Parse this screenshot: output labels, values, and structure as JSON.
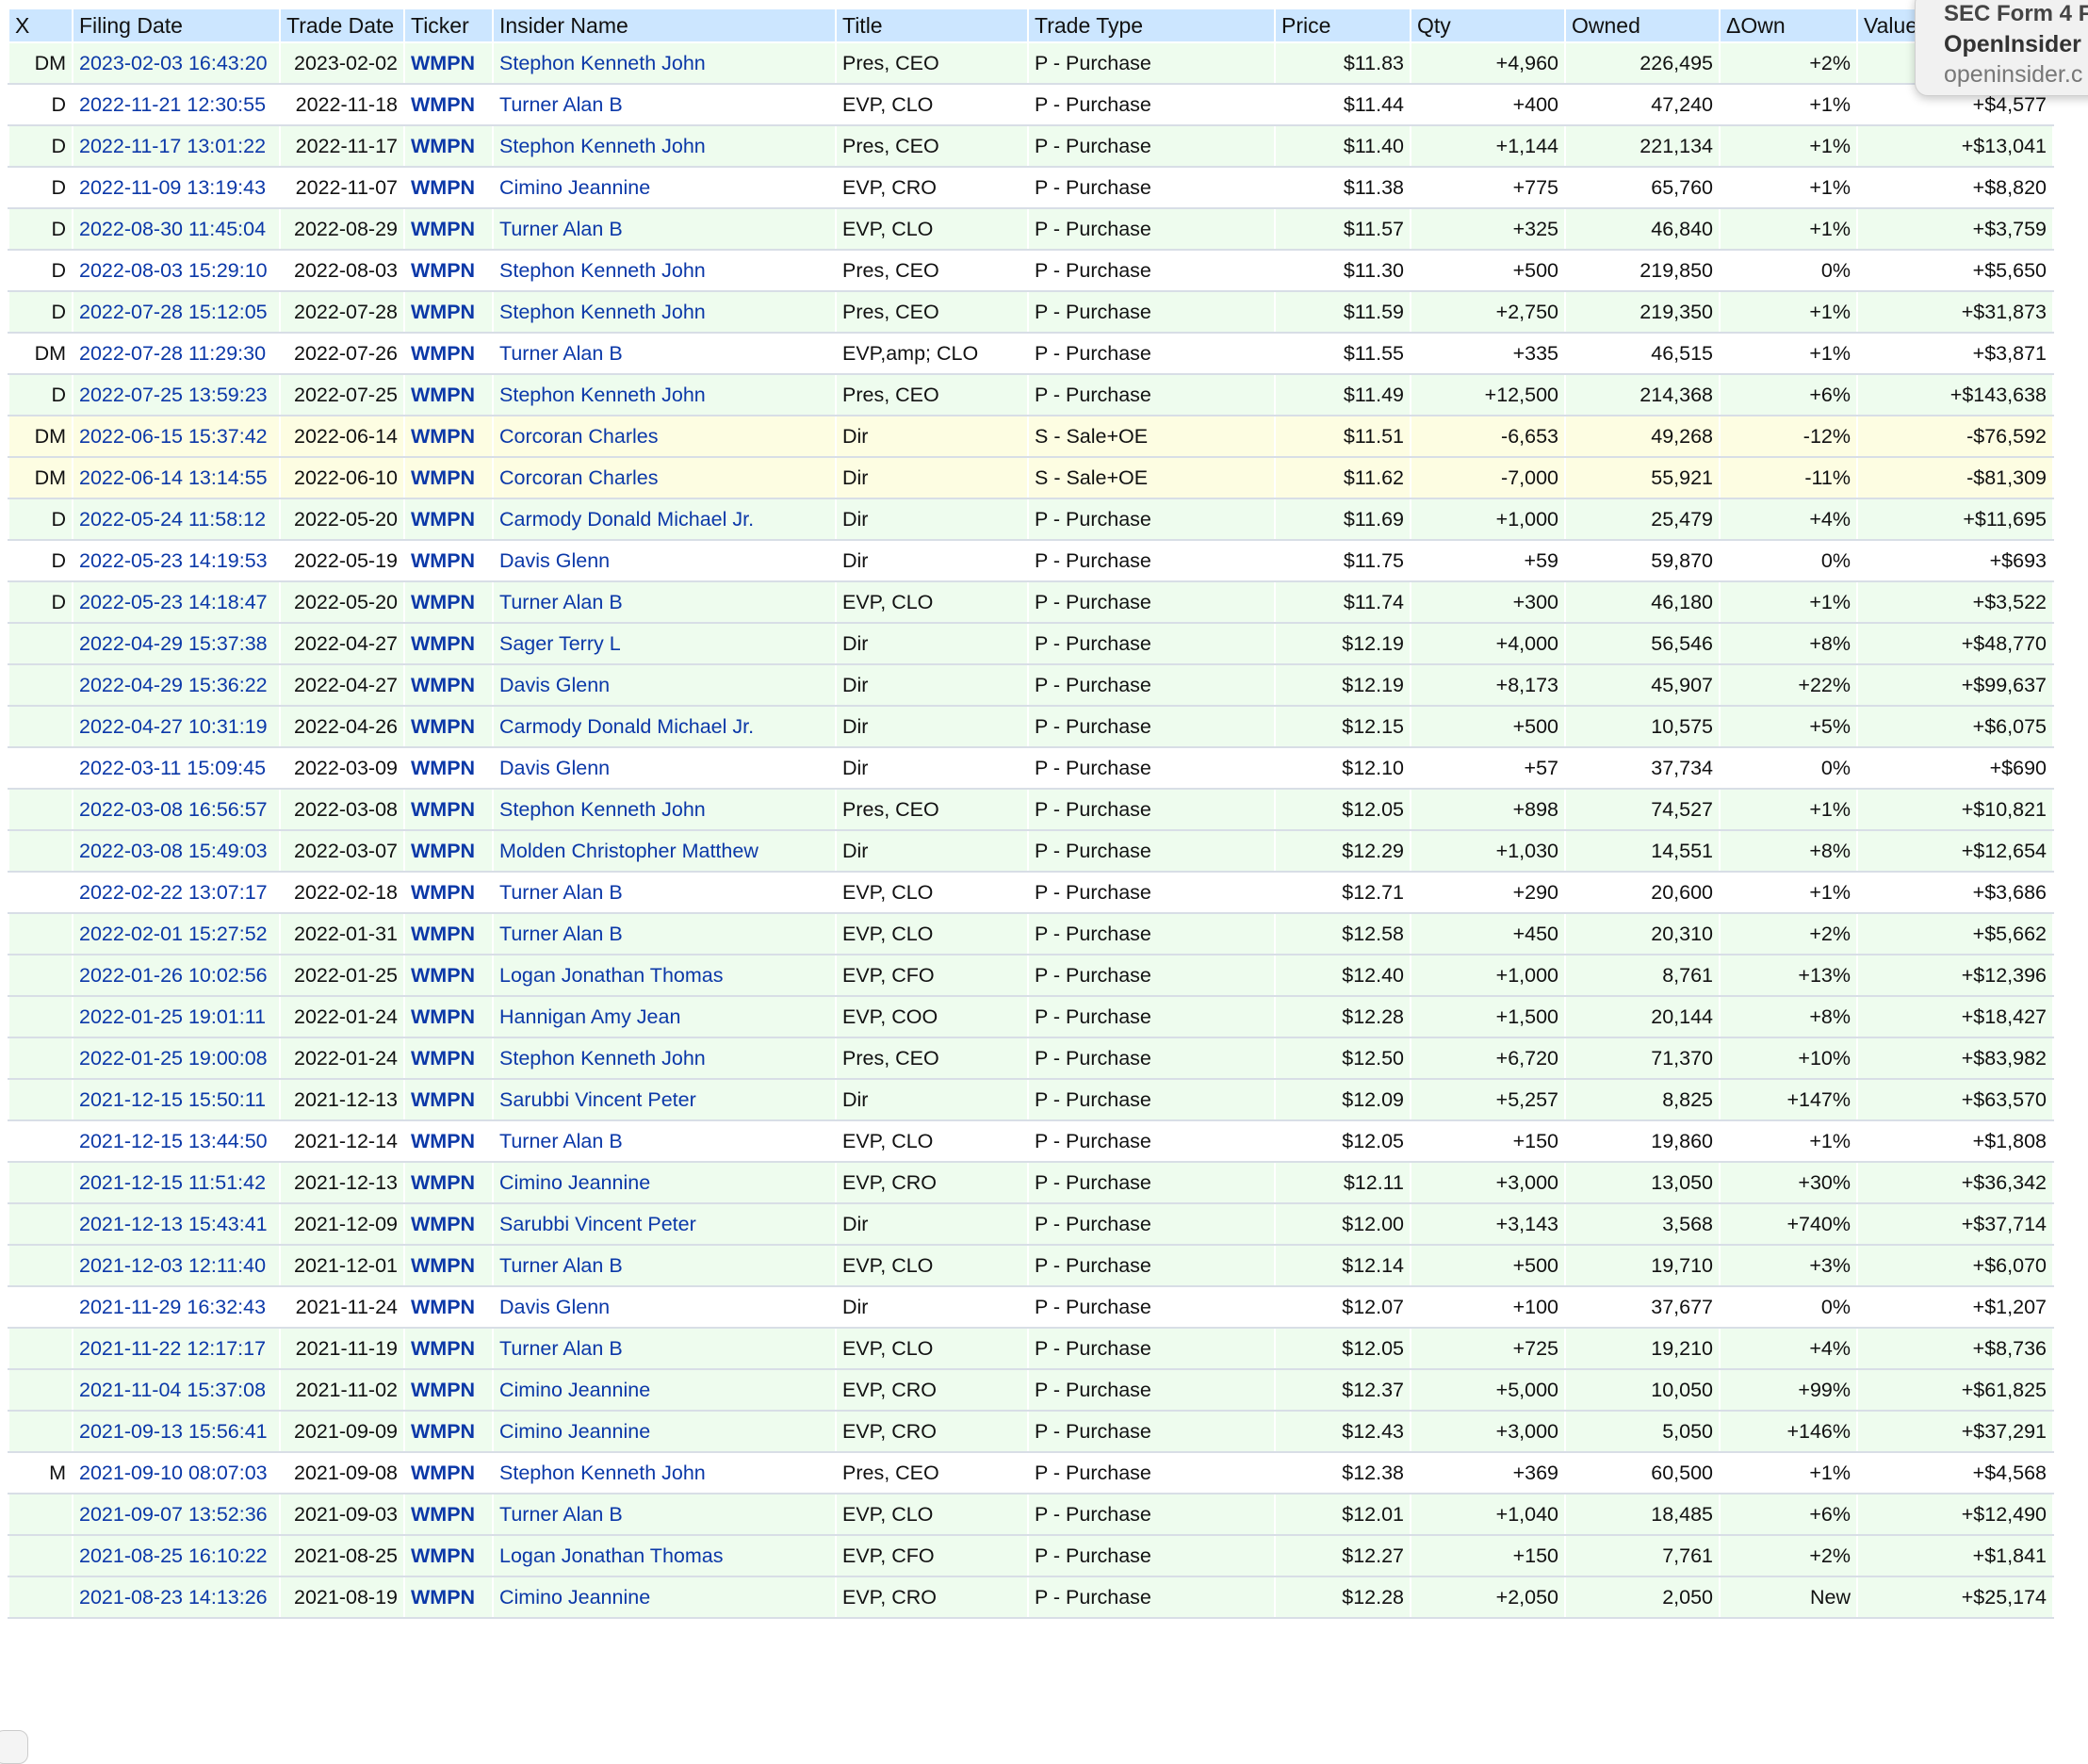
{
  "columns": [
    "X",
    "Filing Date",
    "Trade Date",
    "Ticker",
    "Insider Name",
    "Title",
    "Trade Type",
    "Price",
    "Qty",
    "Owned",
    "ΔOwn",
    "Value"
  ],
  "tooltip": {
    "line1": "SEC Form 4 F",
    "line2": "OpenInsider",
    "line3": "openinsider.c"
  },
  "rows": [
    {
      "x": "DM",
      "filing": "2023-02-03 16:43:20",
      "trade": "2023-02-02",
      "ticker": "WMPN",
      "name": "Stephon Kenneth John",
      "title": "Pres, CEO",
      "type": "P - Purchase",
      "price": "$11.83",
      "qty": "+4,960",
      "owned": "226,495",
      "down": "+2%",
      "value": "",
      "kind": "buy"
    },
    {
      "x": "D",
      "filing": "2022-11-21 12:30:55",
      "trade": "2022-11-18",
      "ticker": "WMPN",
      "name": "Turner Alan B",
      "title": "EVP, CLO",
      "type": "P - Purchase",
      "price": "$11.44",
      "qty": "+400",
      "owned": "47,240",
      "down": "+1%",
      "value": "+$4,577",
      "kind": "plain"
    },
    {
      "x": "D",
      "filing": "2022-11-17 13:01:22",
      "trade": "2022-11-17",
      "ticker": "WMPN",
      "name": "Stephon Kenneth John",
      "title": "Pres, CEO",
      "type": "P - Purchase",
      "price": "$11.40",
      "qty": "+1,144",
      "owned": "221,134",
      "down": "+1%",
      "value": "+$13,041",
      "kind": "buy"
    },
    {
      "x": "D",
      "filing": "2022-11-09 13:19:43",
      "trade": "2022-11-07",
      "ticker": "WMPN",
      "name": "Cimino Jeannine",
      "title": "EVP, CRO",
      "type": "P - Purchase",
      "price": "$11.38",
      "qty": "+775",
      "owned": "65,760",
      "down": "+1%",
      "value": "+$8,820",
      "kind": "plain"
    },
    {
      "x": "D",
      "filing": "2022-08-30 11:45:04",
      "trade": "2022-08-29",
      "ticker": "WMPN",
      "name": "Turner Alan B",
      "title": "EVP, CLO",
      "type": "P - Purchase",
      "price": "$11.57",
      "qty": "+325",
      "owned": "46,840",
      "down": "+1%",
      "value": "+$3,759",
      "kind": "buy"
    },
    {
      "x": "D",
      "filing": "2022-08-03 15:29:10",
      "trade": "2022-08-03",
      "ticker": "WMPN",
      "name": "Stephon Kenneth John",
      "title": "Pres, CEO",
      "type": "P - Purchase",
      "price": "$11.30",
      "qty": "+500",
      "owned": "219,850",
      "down": "0%",
      "value": "+$5,650",
      "kind": "plain"
    },
    {
      "x": "D",
      "filing": "2022-07-28 15:12:05",
      "trade": "2022-07-28",
      "ticker": "WMPN",
      "name": "Stephon Kenneth John",
      "title": "Pres, CEO",
      "type": "P - Purchase",
      "price": "$11.59",
      "qty": "+2,750",
      "owned": "219,350",
      "down": "+1%",
      "value": "+$31,873",
      "kind": "buy"
    },
    {
      "x": "DM",
      "filing": "2022-07-28 11:29:30",
      "trade": "2022-07-26",
      "ticker": "WMPN",
      "name": "Turner Alan B",
      "title": "EVP,amp; CLO",
      "type": "P - Purchase",
      "price": "$11.55",
      "qty": "+335",
      "owned": "46,515",
      "down": "+1%",
      "value": "+$3,871",
      "kind": "plain"
    },
    {
      "x": "D",
      "filing": "2022-07-25 13:59:23",
      "trade": "2022-07-25",
      "ticker": "WMPN",
      "name": "Stephon Kenneth John",
      "title": "Pres, CEO",
      "type": "P - Purchase",
      "price": "$11.49",
      "qty": "+12,500",
      "owned": "214,368",
      "down": "+6%",
      "value": "+$143,638",
      "kind": "buy"
    },
    {
      "x": "DM",
      "filing": "2022-06-15 15:37:42",
      "trade": "2022-06-14",
      "ticker": "WMPN",
      "name": "Corcoran Charles",
      "title": "Dir",
      "type": "S - Sale+OE",
      "price": "$11.51",
      "qty": "-6,653",
      "owned": "49,268",
      "down": "-12%",
      "value": "-$76,592",
      "kind": "sell"
    },
    {
      "x": "DM",
      "filing": "2022-06-14 13:14:55",
      "trade": "2022-06-10",
      "ticker": "WMPN",
      "name": "Corcoran Charles",
      "title": "Dir",
      "type": "S - Sale+OE",
      "price": "$11.62",
      "qty": "-7,000",
      "owned": "55,921",
      "down": "-11%",
      "value": "-$81,309",
      "kind": "sell"
    },
    {
      "x": "D",
      "filing": "2022-05-24 11:58:12",
      "trade": "2022-05-20",
      "ticker": "WMPN",
      "name": "Carmody Donald Michael Jr.",
      "title": "Dir",
      "type": "P - Purchase",
      "price": "$11.69",
      "qty": "+1,000",
      "owned": "25,479",
      "down": "+4%",
      "value": "+$11,695",
      "kind": "buy"
    },
    {
      "x": "D",
      "filing": "2022-05-23 14:19:53",
      "trade": "2022-05-19",
      "ticker": "WMPN",
      "name": "Davis Glenn",
      "title": "Dir",
      "type": "P - Purchase",
      "price": "$11.75",
      "qty": "+59",
      "owned": "59,870",
      "down": "0%",
      "value": "+$693",
      "kind": "plain"
    },
    {
      "x": "D",
      "filing": "2022-05-23 14:18:47",
      "trade": "2022-05-20",
      "ticker": "WMPN",
      "name": "Turner Alan B",
      "title": "EVP, CLO",
      "type": "P - Purchase",
      "price": "$11.74",
      "qty": "+300",
      "owned": "46,180",
      "down": "+1%",
      "value": "+$3,522",
      "kind": "buy"
    },
    {
      "x": "",
      "filing": "2022-04-29 15:37:38",
      "trade": "2022-04-27",
      "ticker": "WMPN",
      "name": "Sager Terry L",
      "title": "Dir",
      "type": "P - Purchase",
      "price": "$12.19",
      "qty": "+4,000",
      "owned": "56,546",
      "down": "+8%",
      "value": "+$48,770",
      "kind": "buy"
    },
    {
      "x": "",
      "filing": "2022-04-29 15:36:22",
      "trade": "2022-04-27",
      "ticker": "WMPN",
      "name": "Davis Glenn",
      "title": "Dir",
      "type": "P - Purchase",
      "price": "$12.19",
      "qty": "+8,173",
      "owned": "45,907",
      "down": "+22%",
      "value": "+$99,637",
      "kind": "buy"
    },
    {
      "x": "",
      "filing": "2022-04-27 10:31:19",
      "trade": "2022-04-26",
      "ticker": "WMPN",
      "name": "Carmody Donald Michael Jr.",
      "title": "Dir",
      "type": "P - Purchase",
      "price": "$12.15",
      "qty": "+500",
      "owned": "10,575",
      "down": "+5%",
      "value": "+$6,075",
      "kind": "buy"
    },
    {
      "x": "",
      "filing": "2022-03-11 15:09:45",
      "trade": "2022-03-09",
      "ticker": "WMPN",
      "name": "Davis Glenn",
      "title": "Dir",
      "type": "P - Purchase",
      "price": "$12.10",
      "qty": "+57",
      "owned": "37,734",
      "down": "0%",
      "value": "+$690",
      "kind": "plain"
    },
    {
      "x": "",
      "filing": "2022-03-08 16:56:57",
      "trade": "2022-03-08",
      "ticker": "WMPN",
      "name": "Stephon Kenneth John",
      "title": "Pres, CEO",
      "type": "P - Purchase",
      "price": "$12.05",
      "qty": "+898",
      "owned": "74,527",
      "down": "+1%",
      "value": "+$10,821",
      "kind": "buy"
    },
    {
      "x": "",
      "filing": "2022-03-08 15:49:03",
      "trade": "2022-03-07",
      "ticker": "WMPN",
      "name": "Molden Christopher Matthew",
      "title": "Dir",
      "type": "P - Purchase",
      "price": "$12.29",
      "qty": "+1,030",
      "owned": "14,551",
      "down": "+8%",
      "value": "+$12,654",
      "kind": "buy"
    },
    {
      "x": "",
      "filing": "2022-02-22 13:07:17",
      "trade": "2022-02-18",
      "ticker": "WMPN",
      "name": "Turner Alan B",
      "title": "EVP, CLO",
      "type": "P - Purchase",
      "price": "$12.71",
      "qty": "+290",
      "owned": "20,600",
      "down": "+1%",
      "value": "+$3,686",
      "kind": "plain"
    },
    {
      "x": "",
      "filing": "2022-02-01 15:27:52",
      "trade": "2022-01-31",
      "ticker": "WMPN",
      "name": "Turner Alan B",
      "title": "EVP, CLO",
      "type": "P - Purchase",
      "price": "$12.58",
      "qty": "+450",
      "owned": "20,310",
      "down": "+2%",
      "value": "+$5,662",
      "kind": "buy"
    },
    {
      "x": "",
      "filing": "2022-01-26 10:02:56",
      "trade": "2022-01-25",
      "ticker": "WMPN",
      "name": "Logan Jonathan Thomas",
      "title": "EVP, CFO",
      "type": "P - Purchase",
      "price": "$12.40",
      "qty": "+1,000",
      "owned": "8,761",
      "down": "+13%",
      "value": "+$12,396",
      "kind": "buy"
    },
    {
      "x": "",
      "filing": "2022-01-25 19:01:11",
      "trade": "2022-01-24",
      "ticker": "WMPN",
      "name": "Hannigan Amy Jean",
      "title": "EVP, COO",
      "type": "P - Purchase",
      "price": "$12.28",
      "qty": "+1,500",
      "owned": "20,144",
      "down": "+8%",
      "value": "+$18,427",
      "kind": "buy"
    },
    {
      "x": "",
      "filing": "2022-01-25 19:00:08",
      "trade": "2022-01-24",
      "ticker": "WMPN",
      "name": "Stephon Kenneth John",
      "title": "Pres, CEO",
      "type": "P - Purchase",
      "price": "$12.50",
      "qty": "+6,720",
      "owned": "71,370",
      "down": "+10%",
      "value": "+$83,982",
      "kind": "buy"
    },
    {
      "x": "",
      "filing": "2021-12-15 15:50:11",
      "trade": "2021-12-13",
      "ticker": "WMPN",
      "name": "Sarubbi Vincent Peter",
      "title": "Dir",
      "type": "P - Purchase",
      "price": "$12.09",
      "qty": "+5,257",
      "owned": "8,825",
      "down": "+147%",
      "value": "+$63,570",
      "kind": "buy"
    },
    {
      "x": "",
      "filing": "2021-12-15 13:44:50",
      "trade": "2021-12-14",
      "ticker": "WMPN",
      "name": "Turner Alan B",
      "title": "EVP, CLO",
      "type": "P - Purchase",
      "price": "$12.05",
      "qty": "+150",
      "owned": "19,860",
      "down": "+1%",
      "value": "+$1,808",
      "kind": "plain"
    },
    {
      "x": "",
      "filing": "2021-12-15 11:51:42",
      "trade": "2021-12-13",
      "ticker": "WMPN",
      "name": "Cimino Jeannine",
      "title": "EVP, CRO",
      "type": "P - Purchase",
      "price": "$12.11",
      "qty": "+3,000",
      "owned": "13,050",
      "down": "+30%",
      "value": "+$36,342",
      "kind": "buy"
    },
    {
      "x": "",
      "filing": "2021-12-13 15:43:41",
      "trade": "2021-12-09",
      "ticker": "WMPN",
      "name": "Sarubbi Vincent Peter",
      "title": "Dir",
      "type": "P - Purchase",
      "price": "$12.00",
      "qty": "+3,143",
      "owned": "3,568",
      "down": "+740%",
      "value": "+$37,714",
      "kind": "buy"
    },
    {
      "x": "",
      "filing": "2021-12-03 12:11:40",
      "trade": "2021-12-01",
      "ticker": "WMPN",
      "name": "Turner Alan B",
      "title": "EVP, CLO",
      "type": "P - Purchase",
      "price": "$12.14",
      "qty": "+500",
      "owned": "19,710",
      "down": "+3%",
      "value": "+$6,070",
      "kind": "buy"
    },
    {
      "x": "",
      "filing": "2021-11-29 16:32:43",
      "trade": "2021-11-24",
      "ticker": "WMPN",
      "name": "Davis Glenn",
      "title": "Dir",
      "type": "P - Purchase",
      "price": "$12.07",
      "qty": "+100",
      "owned": "37,677",
      "down": "0%",
      "value": "+$1,207",
      "kind": "plain"
    },
    {
      "x": "",
      "filing": "2021-11-22 12:17:17",
      "trade": "2021-11-19",
      "ticker": "WMPN",
      "name": "Turner Alan B",
      "title": "EVP, CLO",
      "type": "P - Purchase",
      "price": "$12.05",
      "qty": "+725",
      "owned": "19,210",
      "down": "+4%",
      "value": "+$8,736",
      "kind": "buy"
    },
    {
      "x": "",
      "filing": "2021-11-04 15:37:08",
      "trade": "2021-11-02",
      "ticker": "WMPN",
      "name": "Cimino Jeannine",
      "title": "EVP, CRO",
      "type": "P - Purchase",
      "price": "$12.37",
      "qty": "+5,000",
      "owned": "10,050",
      "down": "+99%",
      "value": "+$61,825",
      "kind": "buy"
    },
    {
      "x": "",
      "filing": "2021-09-13 15:56:41",
      "trade": "2021-09-09",
      "ticker": "WMPN",
      "name": "Cimino Jeannine",
      "title": "EVP, CRO",
      "type": "P - Purchase",
      "price": "$12.43",
      "qty": "+3,000",
      "owned": "5,050",
      "down": "+146%",
      "value": "+$37,291",
      "kind": "buy"
    },
    {
      "x": "M",
      "filing": "2021-09-10 08:07:03",
      "trade": "2021-09-08",
      "ticker": "WMPN",
      "name": "Stephon Kenneth John",
      "title": "Pres, CEO",
      "type": "P - Purchase",
      "price": "$12.38",
      "qty": "+369",
      "owned": "60,500",
      "down": "+1%",
      "value": "+$4,568",
      "kind": "plain"
    },
    {
      "x": "",
      "filing": "2021-09-07 13:52:36",
      "trade": "2021-09-03",
      "ticker": "WMPN",
      "name": "Turner Alan B",
      "title": "EVP, CLO",
      "type": "P - Purchase",
      "price": "$12.01",
      "qty": "+1,040",
      "owned": "18,485",
      "down": "+6%",
      "value": "+$12,490",
      "kind": "buy"
    },
    {
      "x": "",
      "filing": "2021-08-25 16:10:22",
      "trade": "2021-08-25",
      "ticker": "WMPN",
      "name": "Logan Jonathan Thomas",
      "title": "EVP, CFO",
      "type": "P - Purchase",
      "price": "$12.27",
      "qty": "+150",
      "owned": "7,761",
      "down": "+2%",
      "value": "+$1,841",
      "kind": "buy"
    },
    {
      "x": "",
      "filing": "2021-08-23 14:13:26",
      "trade": "2021-08-19",
      "ticker": "WMPN",
      "name": "Cimino Jeannine",
      "title": "EVP, CRO",
      "type": "P - Purchase",
      "price": "$12.28",
      "qty": "+2,050",
      "owned": "2,050",
      "down": "New",
      "value": "+$25,174",
      "kind": "buy"
    }
  ]
}
